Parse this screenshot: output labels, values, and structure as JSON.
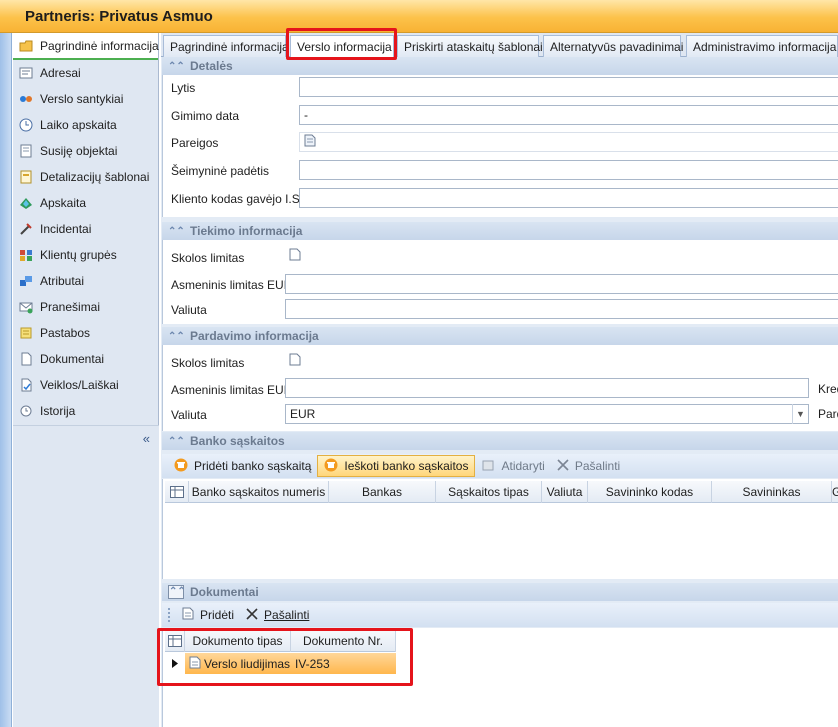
{
  "window": {
    "title": "Partneris: Privatus Asmuo"
  },
  "sidebar": {
    "items": [
      {
        "label": "Pagrindinė informacija",
        "icon": "folder-icon"
      },
      {
        "label": "Adresai",
        "icon": "address-icon"
      },
      {
        "label": "Verslo santykiai",
        "icon": "relations-icon"
      },
      {
        "label": "Laiko apskaita",
        "icon": "clock-icon"
      },
      {
        "label": "Susiję objektai",
        "icon": "linked-objects-icon"
      },
      {
        "label": "Detalizacijų šablonai",
        "icon": "templates-icon"
      },
      {
        "label": "Apskaita",
        "icon": "accounting-icon"
      },
      {
        "label": "Incidentai",
        "icon": "incident-icon"
      },
      {
        "label": "Klientų grupės",
        "icon": "groups-icon"
      },
      {
        "label": "Atributai",
        "icon": "attributes-icon"
      },
      {
        "label": "Pranešimai",
        "icon": "messages-icon"
      },
      {
        "label": "Pastabos",
        "icon": "notes-icon"
      },
      {
        "label": "Dokumentai",
        "icon": "documents-icon"
      },
      {
        "label": "Veiklos/Laiškai",
        "icon": "activities-icon"
      },
      {
        "label": "Istorija",
        "icon": "history-icon"
      }
    ],
    "collapse_glyph": "«"
  },
  "tabs": [
    {
      "label": "Pagrindinė informacija"
    },
    {
      "label": "Verslo informacija"
    },
    {
      "label": "Priskirti ataskaitų šablonai"
    },
    {
      "label": "Alternatyvūs pavadinimai"
    },
    {
      "label": "Administravimo informacija"
    }
  ],
  "details": {
    "header": "Detalės",
    "gender_label": "Lytis",
    "birthdate_label": "Gimimo data",
    "birthdate_value": "-",
    "positions_label": "Pareigos",
    "family_label": "Šeimyninė padėtis",
    "client_code_label": "Kliento kodas gavėjo I.S."
  },
  "supply": {
    "header": "Tiekimo informacija",
    "debt_limit_label": "Skolos limitas",
    "personal_limit_label": "Asmeninis limitas EUR",
    "currency_label": "Valiuta"
  },
  "sales": {
    "header": "Pardavimo informacija",
    "debt_limit_label": "Skolos limitas",
    "personal_limit_label": "Asmeninis limitas EUR",
    "currency_label": "Valiuta",
    "currency_value": "EUR",
    "credit_label_partial": "Kred",
    "sales_label_partial": "Pard"
  },
  "bank": {
    "header": "Banko sąskaitos",
    "add_label": "Pridėti banko sąskaitą",
    "search_label": "Ieškoti banko sąskaitos",
    "open_label": "Atidaryti",
    "remove_label": "Pašalinti",
    "columns": [
      "Banko sąskaitos numeris",
      "Bankas",
      "Sąskaitos tipas",
      "Valiuta",
      "Savininko kodas",
      "Savininkas",
      "G"
    ]
  },
  "documents": {
    "header": "Dokumentai",
    "add_label": "Pridėti",
    "remove_label": "Pašalinti",
    "columns": [
      "Dokumento tipas",
      "Dokumento Nr."
    ],
    "rows": [
      {
        "type": "Verslo liudijimas",
        "number": "IV-253"
      }
    ]
  },
  "colors": {
    "title_bar": "#fcc24a",
    "highlight_box": "#e5141b",
    "selected_row": "#ffb74d"
  }
}
